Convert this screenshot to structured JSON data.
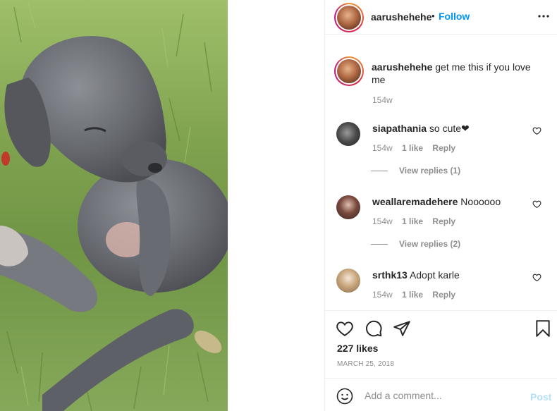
{
  "post": {
    "author": "aarushehehe",
    "separator": "•",
    "follow_label": "Follow",
    "more_icon": "more-horizontal-icon"
  },
  "caption": {
    "username": "aarushehehe",
    "text": "get me this if you love me",
    "time": "154w"
  },
  "comments": [
    {
      "username": "siapathania",
      "text": "so cute❤",
      "time": "154w",
      "likes": "1 like",
      "reply": "Reply",
      "view_replies": "View replies (1)",
      "avatar_color": "#4a4a4a"
    },
    {
      "username": "weallaremadehere",
      "text": "Noooooo",
      "time": "154w",
      "likes": "1 like",
      "reply": "Reply",
      "view_replies": "View replies (2)",
      "avatar_color": "#7a4a3e"
    },
    {
      "username": "srthk13",
      "text": "Adopt karle",
      "time": "154w",
      "likes": "1 like",
      "reply": "Reply",
      "view_replies": "",
      "avatar_color": "#c9a77e"
    }
  ],
  "actions": {
    "icons": [
      "heart-icon",
      "comment-icon",
      "share-icon",
      "bookmark-icon"
    ],
    "likes": "227 likes",
    "date": "MARCH 25, 2018"
  },
  "comment_box": {
    "placeholder": "Add a comment...",
    "post_label": "Post",
    "emoji_icon": "smiley-icon"
  },
  "colors": {
    "follow_blue": "#0095f6",
    "post_disabled_blue": "#b2dffc",
    "muted_text": "#8e8e8e"
  }
}
